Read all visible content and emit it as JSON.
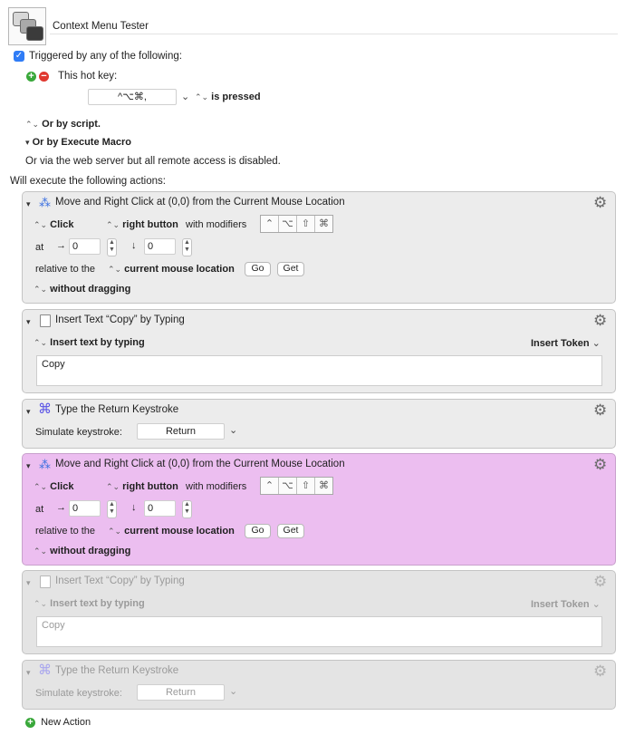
{
  "macro": {
    "name": "Context Menu Tester",
    "trigger_label": "Triggered by any of the following:",
    "hotkey_label": "This hot key:",
    "hotkey_value": "^⌥⌘,",
    "hotkey_state": "is pressed",
    "or_by_script": "Or by script.",
    "or_by_execute": "Or by Execute Macro",
    "web_server_text": "Or via the web server but all remote access is disabled.",
    "will_execute": "Will execute the following actions:",
    "new_action": "New Action"
  },
  "actions": [
    {
      "title": "Move and Right Click at (0,0) from the Current Mouse Location",
      "click": "Click",
      "button": "right button",
      "with_modifiers": "with modifiers",
      "modifiers": [
        "⌃",
        "⌥",
        "⇧",
        "⌘"
      ],
      "at_label": "at",
      "x_arrow": "→",
      "x": "0",
      "y_arrow": "↓",
      "y": "0",
      "relative_label": "relative to the",
      "relative": "current mouse location",
      "go": "Go",
      "get": "Get",
      "dragging": "without dragging"
    },
    {
      "title": "Insert Text “Copy” by Typing",
      "mode": "Insert text by typing",
      "token": "Insert Token",
      "text": "Copy"
    },
    {
      "title": "Type the Return Keystroke",
      "simulate_label": "Simulate keystroke:",
      "key": "Return"
    },
    {
      "title": "Move and Right Click at (0,0) from the Current Mouse Location",
      "click": "Click",
      "button": "right button",
      "with_modifiers": "with modifiers",
      "modifiers": [
        "⌃",
        "⌥",
        "⇧",
        "⌘"
      ],
      "at_label": "at",
      "x_arrow": "→",
      "x": "0",
      "y_arrow": "↓",
      "y": "0",
      "relative_label": "relative to the",
      "relative": "current mouse location",
      "go": "Go",
      "get": "Get",
      "dragging": "without dragging"
    },
    {
      "title": "Insert Text “Copy” by Typing",
      "mode": "Insert text by typing",
      "token": "Insert Token",
      "text": "Copy"
    },
    {
      "title": "Type the Return Keystroke",
      "simulate_label": "Simulate keystroke:",
      "key": "Return"
    }
  ],
  "icons": {
    "collapse": "▾",
    "updown": "⌃⌄",
    "gear": "⚙",
    "cmd": "⌘",
    "chevron": "⌄"
  },
  "colors": {
    "selected_action": "#ecbef0",
    "accent_checkbox": "#2f7cf6",
    "plus": "#39a83a",
    "minus": "#e0382f"
  }
}
